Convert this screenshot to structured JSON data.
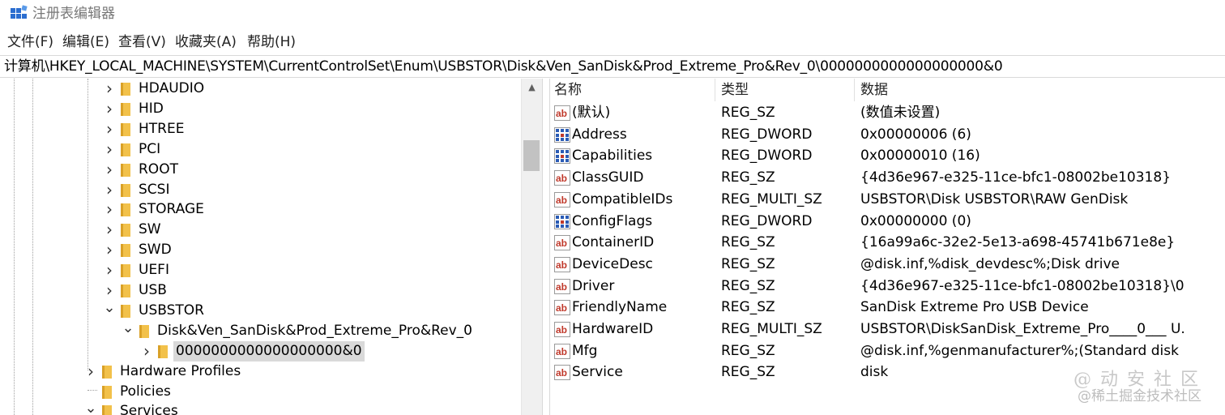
{
  "window": {
    "title": "注册表编辑器"
  },
  "menu": [
    "文件(F)",
    "编辑(E)",
    "查看(V)",
    "收藏夹(A)",
    "帮助(H)"
  ],
  "address": "计算机\\HKEY_LOCAL_MACHINE\\SYSTEM\\CurrentControlSet\\Enum\\USBSTOR\\Disk&Ven_SanDisk&Prod_Extreme_Pro&Rev_0\\0000000000000000000&0",
  "tree": [
    {
      "label": "HDAUDIO",
      "expanded": false,
      "depth": 2
    },
    {
      "label": "HID",
      "expanded": false,
      "depth": 2
    },
    {
      "label": "HTREE",
      "expanded": false,
      "depth": 2
    },
    {
      "label": "PCI",
      "expanded": false,
      "depth": 2
    },
    {
      "label": "ROOT",
      "expanded": false,
      "depth": 2
    },
    {
      "label": "SCSI",
      "expanded": false,
      "depth": 2
    },
    {
      "label": "STORAGE",
      "expanded": false,
      "depth": 2
    },
    {
      "label": "SW",
      "expanded": false,
      "depth": 2
    },
    {
      "label": "SWD",
      "expanded": false,
      "depth": 2
    },
    {
      "label": "UEFI",
      "expanded": false,
      "depth": 2
    },
    {
      "label": "USB",
      "expanded": false,
      "depth": 2
    },
    {
      "label": "USBSTOR",
      "expanded": true,
      "depth": 2
    },
    {
      "label": "Disk&Ven_SanDisk&Prod_Extreme_Pro&Rev_0",
      "expanded": true,
      "depth": 3
    },
    {
      "label": "0000000000000000000&0",
      "expanded": false,
      "depth": 4,
      "selected": true
    },
    {
      "label": "Hardware Profiles",
      "expanded": false,
      "depth": 1
    },
    {
      "label": "Policies",
      "expanded": null,
      "depth": 1
    },
    {
      "label": "Services",
      "expanded": true,
      "depth": 1
    }
  ],
  "columns": {
    "name": "名称",
    "type": "类型",
    "data": "数据"
  },
  "values": [
    {
      "icon": "ab",
      "name": "(默认)",
      "type": "REG_SZ",
      "data": "(数值未设置)"
    },
    {
      "icon": "bin",
      "name": "Address",
      "type": "REG_DWORD",
      "data": "0x00000006 (6)"
    },
    {
      "icon": "bin",
      "name": "Capabilities",
      "type": "REG_DWORD",
      "data": "0x00000010 (16)"
    },
    {
      "icon": "ab",
      "name": "ClassGUID",
      "type": "REG_SZ",
      "data": "{4d36e967-e325-11ce-bfc1-08002be10318}"
    },
    {
      "icon": "ab",
      "name": "CompatibleIDs",
      "type": "REG_MULTI_SZ",
      "data": "USBSTOR\\Disk USBSTOR\\RAW GenDisk"
    },
    {
      "icon": "bin",
      "name": "ConfigFlags",
      "type": "REG_DWORD",
      "data": "0x00000000 (0)"
    },
    {
      "icon": "ab",
      "name": "ContainerID",
      "type": "REG_SZ",
      "data": "{16a99a6c-32e2-5e13-a698-45741b671e8e}"
    },
    {
      "icon": "ab",
      "name": "DeviceDesc",
      "type": "REG_SZ",
      "data": "@disk.inf,%disk_devdesc%;Disk drive"
    },
    {
      "icon": "ab",
      "name": "Driver",
      "type": "REG_SZ",
      "data": "{4d36e967-e325-11ce-bfc1-08002be10318}\\0..."
    },
    {
      "icon": "ab",
      "name": "FriendlyName",
      "type": "REG_SZ",
      "data": "SanDisk Extreme Pro USB Device"
    },
    {
      "icon": "ab",
      "name": "HardwareID",
      "type": "REG_MULTI_SZ",
      "data": "USBSTOR\\DiskSanDisk_Extreme_Pro____0___ U..."
    },
    {
      "icon": "ab",
      "name": "Mfg",
      "type": "REG_SZ",
      "data": "@disk.inf,%genmanufacturer%;(Standard disk ..."
    },
    {
      "icon": "ab",
      "name": "Service",
      "type": "REG_SZ",
      "data": "disk"
    }
  ],
  "watermark": {
    "line1": "@ 动 安 社 区",
    "line2": "@稀土掘金技术社区"
  },
  "icons": {
    "app": "regedit-icon",
    "folder": "folder-icon",
    "string": "reg-sz-icon",
    "binary": "reg-dword-icon"
  },
  "colors": {
    "folder": "#f2c14a",
    "selection": "#d9d9d9",
    "sz_icon_red": "#c0392b",
    "dword_icon_blue": "#2a5bb5"
  }
}
